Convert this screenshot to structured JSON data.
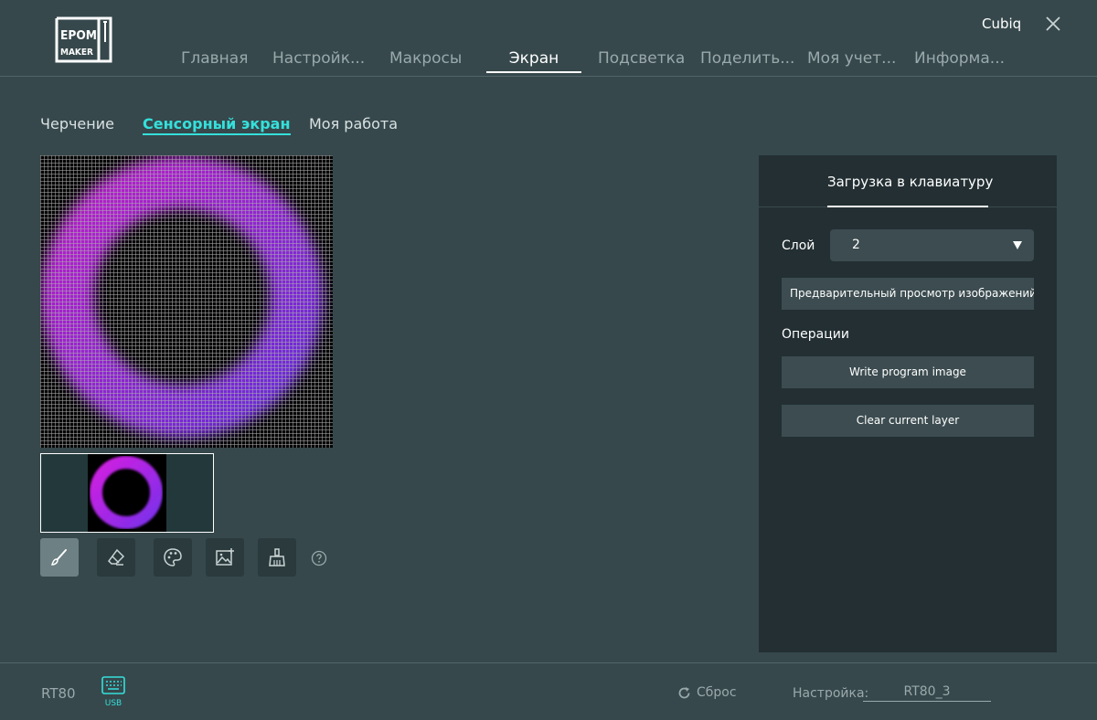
{
  "header": {
    "logo_text_top": "EPOM",
    "logo_text_bottom": "MAKER",
    "user_name": "Cubiq",
    "nav": [
      {
        "label": "Главная"
      },
      {
        "label": "Настройк..."
      },
      {
        "label": "Макросы"
      },
      {
        "label": "Экран"
      },
      {
        "label": "Подсветка"
      },
      {
        "label": "Поделить..."
      },
      {
        "label": "Моя учет..."
      },
      {
        "label": "Информа..."
      }
    ]
  },
  "subtabs": [
    {
      "label": "Черчение"
    },
    {
      "label": "Сенсорный экран"
    },
    {
      "label": "Моя работа"
    }
  ],
  "canvas": {
    "ring_outer_color": "#c41fd6",
    "ring_inner_color": "#6e2fe6"
  },
  "tools": [
    "brush-icon",
    "eraser-icon",
    "palette-icon",
    "image-add-icon",
    "broom-icon",
    "help-icon"
  ],
  "panel": {
    "title": "Загрузка в клавиатуру",
    "layer_label": "Слой",
    "layer_value": "2",
    "preview_label": "Предварительный просмотр изображений",
    "operations_label": "Операции",
    "write_button": "Write program image",
    "clear_button": "Clear current layer"
  },
  "footer": {
    "device": "RT80",
    "connection": "USB",
    "reset_label": "Сброс",
    "setting_label": "Настройка:",
    "setting_value": "RT80_3"
  },
  "colors": {
    "background": "#36484c",
    "panel": "#232f33",
    "accent": "#35e0db"
  }
}
